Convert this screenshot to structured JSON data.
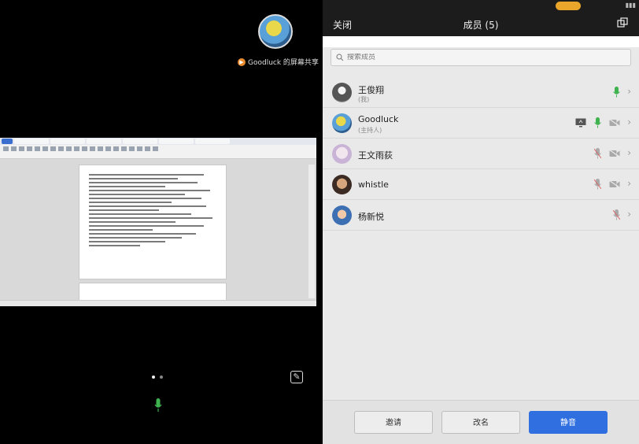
{
  "share": {
    "caption": "Goodluck 的屏幕共享",
    "page_count": 2,
    "active_page": 1
  },
  "panel": {
    "close_label": "关闭",
    "title": "成员 (5)",
    "search_placeholder": "搜索成员"
  },
  "members": [
    {
      "name": "王俊翔",
      "role": "(我)",
      "mic": "on",
      "camera": "none",
      "screen": false
    },
    {
      "name": "Goodluck",
      "role": "(主持人)",
      "mic": "on",
      "camera": "off",
      "screen": true
    },
    {
      "name": "王文雨荻",
      "role": "",
      "mic": "off",
      "camera": "off",
      "screen": false
    },
    {
      "name": "whistle",
      "role": "",
      "mic": "off",
      "camera": "off",
      "screen": false
    },
    {
      "name": "杨新悦",
      "role": "",
      "mic": "off",
      "camera": "none",
      "screen": false
    }
  ],
  "actions": {
    "invite": "邀请",
    "rename": "改名",
    "mute": "静音"
  },
  "colors": {
    "accent": "#2f6fe0",
    "mic_on": "#3fb34f",
    "mic_off": "#a9a9a9",
    "status_pill": "#e9a62b"
  }
}
